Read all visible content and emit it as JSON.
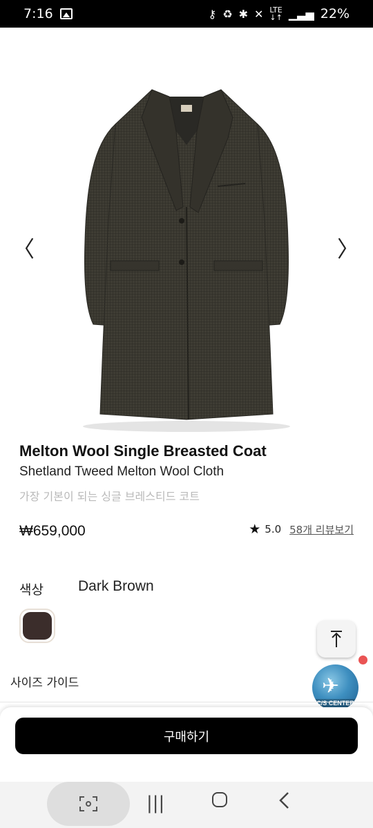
{
  "status_bar": {
    "time": "7:16",
    "battery": "22%",
    "icons": [
      "image-icon",
      "key-icon",
      "recycle-icon",
      "bluetooth-icon",
      "mute-icon",
      "lte-icon",
      "signal-icon"
    ]
  },
  "product": {
    "name": "Melton Wool Single Breasted Coat",
    "fabric": "Shetland Tweed Melton Wool Cloth",
    "description": "가장 기본이 되는 싱글 브레스티드 코트",
    "price": "₩659,000",
    "rating": "5.0",
    "review_link": "58개 리뷰보기"
  },
  "carousel": {
    "prev": "〈",
    "next": "〉"
  },
  "options": {
    "color_label": "색상",
    "color_value": "Dark Brown",
    "swatch_color": "#3b2d2b",
    "size_guide": "사이즈 가이드"
  },
  "floating": {
    "cs_center": "C/S CENTER"
  },
  "purchase": {
    "buy_label": "구매하기"
  },
  "colors": {
    "accent": "#000000",
    "badge_dot": "#ea5454",
    "muted_text": "#b9b9b9"
  }
}
